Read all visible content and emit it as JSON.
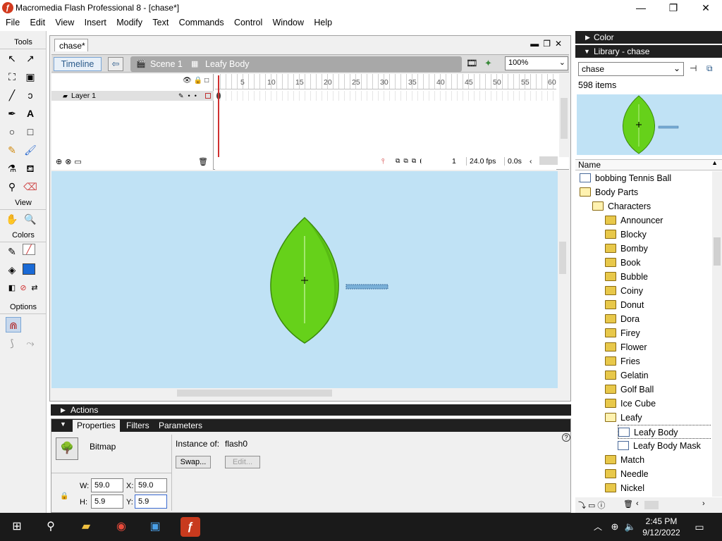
{
  "window": {
    "title": "Macromedia Flash Professional 8 - [chase*]",
    "min": "—",
    "max": "❐",
    "close": "✕"
  },
  "menu": [
    "File",
    "Edit",
    "View",
    "Insert",
    "Modify",
    "Text",
    "Commands",
    "Control",
    "Window",
    "Help"
  ],
  "tools": {
    "title": "Tools",
    "view": "View",
    "colors": "Colors",
    "options": "Options"
  },
  "document": {
    "tab": "chase*",
    "timeline_button": "Timeline",
    "scene": "Scene 1",
    "symbol": "Leafy Body",
    "zoom": "100%",
    "layer": "Layer 1",
    "ruler": [
      "5",
      "10",
      "15",
      "20",
      "25",
      "30",
      "35",
      "40",
      "45",
      "50",
      "55",
      "60"
    ],
    "frame": "1",
    "fps": "24.0 fps",
    "time": "0.0s"
  },
  "actions": {
    "label": "Actions"
  },
  "properties": {
    "tabs": [
      "Properties",
      "Filters",
      "Parameters"
    ],
    "type": "Bitmap",
    "instance_label": "Instance of:",
    "instance_value": "flash0",
    "swap": "Swap...",
    "edit": "Edit...",
    "w_label": "W:",
    "w": "59.0",
    "x_label": "X:",
    "x": "59.0",
    "h_label": "H:",
    "h": "5.9",
    "y_label": "Y:",
    "y": "5.9"
  },
  "panels": {
    "color": "Color",
    "library": "Library - chase"
  },
  "library": {
    "selector": "chase",
    "count": "598 items",
    "name_header": "Name",
    "items": [
      {
        "label": "bobbing Tennis Ball",
        "indent": 0,
        "kind": "sym"
      },
      {
        "label": "Body Parts",
        "indent": 0,
        "kind": "folder-open"
      },
      {
        "label": "Characters",
        "indent": 1,
        "kind": "folder-open"
      },
      {
        "label": "Announcer",
        "indent": 2,
        "kind": "folder"
      },
      {
        "label": "Blocky",
        "indent": 2,
        "kind": "folder"
      },
      {
        "label": "Bomby",
        "indent": 2,
        "kind": "folder"
      },
      {
        "label": "Book",
        "indent": 2,
        "kind": "folder"
      },
      {
        "label": "Bubble",
        "indent": 2,
        "kind": "folder"
      },
      {
        "label": "Coiny",
        "indent": 2,
        "kind": "folder"
      },
      {
        "label": "Donut",
        "indent": 2,
        "kind": "folder"
      },
      {
        "label": "Dora",
        "indent": 2,
        "kind": "folder"
      },
      {
        "label": "Firey",
        "indent": 2,
        "kind": "folder"
      },
      {
        "label": "Flower",
        "indent": 2,
        "kind": "folder"
      },
      {
        "label": "Fries",
        "indent": 2,
        "kind": "folder"
      },
      {
        "label": "Gelatin",
        "indent": 2,
        "kind": "folder"
      },
      {
        "label": "Golf Ball",
        "indent": 2,
        "kind": "folder"
      },
      {
        "label": "Ice Cube",
        "indent": 2,
        "kind": "folder"
      },
      {
        "label": "Leafy",
        "indent": 2,
        "kind": "folder-open"
      },
      {
        "label": "Leafy Body",
        "indent": 3,
        "kind": "sym",
        "selected": true
      },
      {
        "label": "Leafy Body Mask",
        "indent": 3,
        "kind": "sym"
      },
      {
        "label": "Match",
        "indent": 2,
        "kind": "folder"
      },
      {
        "label": "Needle",
        "indent": 2,
        "kind": "folder"
      },
      {
        "label": "Nickel",
        "indent": 2,
        "kind": "folder"
      }
    ]
  },
  "taskbar": {
    "time": "2:45 PM",
    "date": "9/12/2022"
  },
  "colors": {
    "stage": "#c0e2f5",
    "leaf": "#66d11a",
    "leaf_dark": "#4fae0f",
    "accent": "#2a5a8a"
  }
}
